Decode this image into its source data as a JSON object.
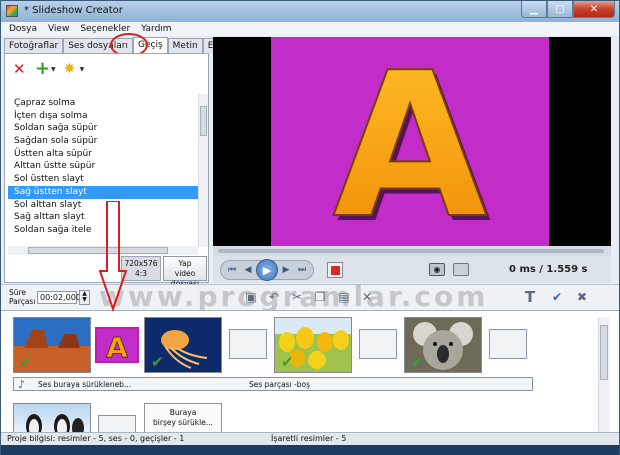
{
  "window": {
    "title": "* Slideshow Creator"
  },
  "menu": [
    "Dosya",
    "View",
    "Seçenekler",
    "Yardım"
  ],
  "tabs": [
    {
      "label": "Fotoğraflar"
    },
    {
      "label": "Ses dosyaları"
    },
    {
      "label": "Geçiş"
    },
    {
      "label": "Metin"
    },
    {
      "label": "Effects"
    }
  ],
  "transitions": [
    "Çapraz solma",
    "İçten dışa solma",
    "Soldan sağa süpür",
    "Sağdan sola süpür",
    "Üstten alta süpür",
    "Alttan üstte süpür",
    "Sol üstten slayt",
    "Sağ üstten slayt",
    "Sol alttan slayt",
    "Sağ alttan slayt",
    "Soldan sağa itele"
  ],
  "resolution": {
    "size": "720x576",
    "ratio": "4:3"
  },
  "make_video": {
    "line1": "Yap",
    "line2": "video dosyası"
  },
  "preview": {
    "letter": "A",
    "time_current": "0 ms",
    "time_total": "/ 1.559 s"
  },
  "duration": {
    "label_line1": "Süre",
    "label_line2": "Parçası",
    "value": "00:02,000"
  },
  "watermark": "www.programlar.com",
  "timeline": {
    "audio_drop_hint": "Ses buraya sürükleneb...",
    "audio_empty": "Ses parçası -boş",
    "drop_line1": "Buraya",
    "drop_line2": "birşey sürükle..."
  },
  "status": {
    "project_info": "Proje bilgisi: resimler - 5, ses - 0, geçişler - 1",
    "selected_info": "İşaretli resimler - 5"
  },
  "colors": {
    "preview_bg": "#c22cc9",
    "letter_fill": "#f5a414",
    "selection": "#3399ff",
    "annotation": "#d91e1e"
  }
}
